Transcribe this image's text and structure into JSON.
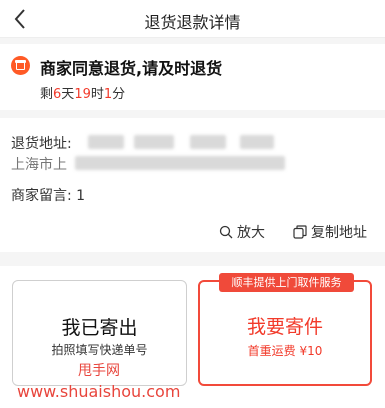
{
  "header": {
    "title": "退货退款详情",
    "back_icon": "chevron-left-icon"
  },
  "status": {
    "icon": "box-icon",
    "title": "商家同意退货,请及时退货",
    "countdown": {
      "prefix": "剩",
      "days": "6",
      "days_unit": "天",
      "hours": "19",
      "hours_unit": "时",
      "minutes": "1",
      "minutes_unit": "分"
    }
  },
  "address": {
    "label": "退货地址:",
    "line2_prefix": "上海市上",
    "message_label": "商家留言:",
    "message_value": "1"
  },
  "actions": {
    "zoom_label": "放大",
    "copy_label": "复制地址"
  },
  "cards": {
    "left": {
      "title": "我已寄出",
      "subtitle": "拍照填写快递单号"
    },
    "right": {
      "badge": "顺丰提供上门取件服务",
      "title": "我要寄件",
      "subtitle": "首重运费 ¥10"
    }
  },
  "watermark": {
    "brand": "甩手网",
    "url": "www.shuaishou.com"
  },
  "colors": {
    "accent": "#f23a2a",
    "status_icon": "#ff5a26"
  }
}
